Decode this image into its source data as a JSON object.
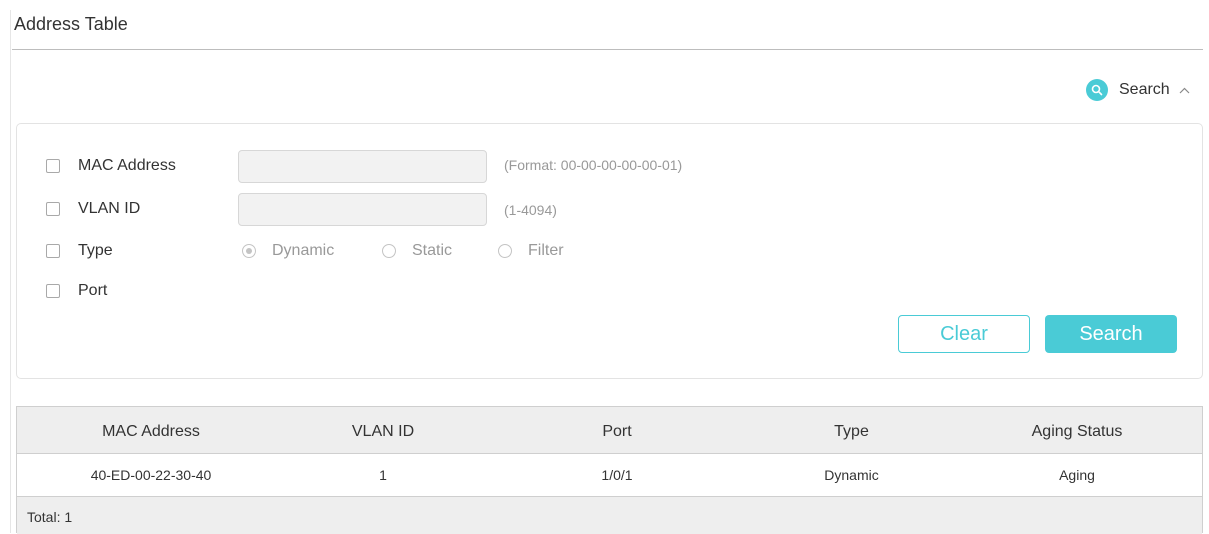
{
  "page": {
    "title": "Address Table"
  },
  "search_toggle": {
    "label": "Search",
    "icon": "search-icon",
    "chevron": "chevron-up-icon",
    "accent": "#4acbd6"
  },
  "search_form": {
    "mac_address": {
      "label": "MAC Address",
      "value": "",
      "hint": "(Format: 00-00-00-00-00-01)",
      "checked": false
    },
    "vlan_id": {
      "label": "VLAN ID",
      "value": "",
      "hint": "(1-4094)",
      "checked": false
    },
    "type": {
      "label": "Type",
      "checked": false,
      "options": [
        {
          "label": "Dynamic",
          "selected": true
        },
        {
          "label": "Static",
          "selected": false
        },
        {
          "label": "Filter",
          "selected": false
        }
      ]
    },
    "port": {
      "label": "Port",
      "checked": false
    },
    "buttons": {
      "clear": "Clear",
      "search": "Search"
    }
  },
  "table": {
    "columns": [
      "MAC Address",
      "VLAN ID",
      "Port",
      "Type",
      "Aging Status"
    ],
    "rows": [
      [
        "40-ED-00-22-30-40",
        "1",
        "1/0/1",
        "Dynamic",
        "Aging"
      ]
    ],
    "footer": "Total: 1"
  }
}
